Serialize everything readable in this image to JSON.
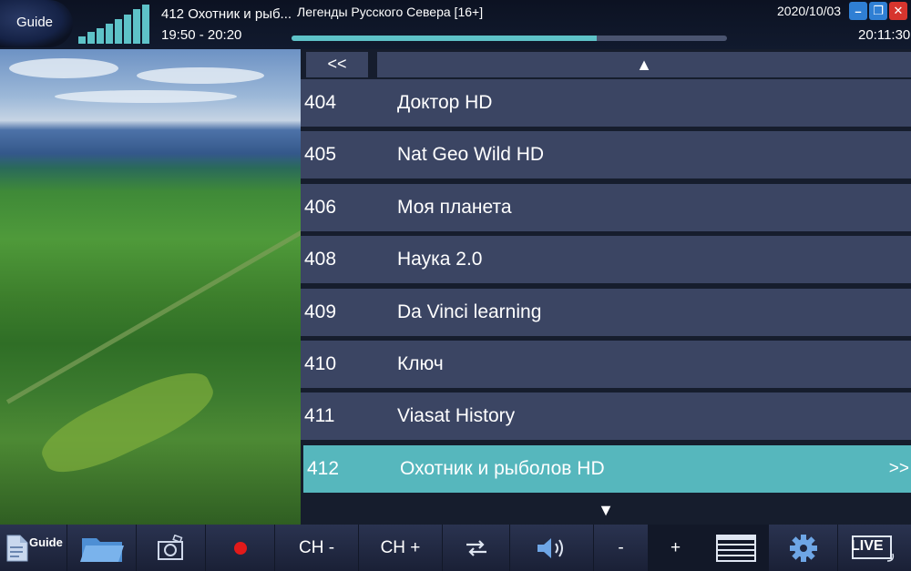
{
  "header": {
    "guide_label": "Guide",
    "signal_levels": [
      0.18,
      0.28,
      0.38,
      0.48,
      0.58,
      0.7,
      0.82,
      0.94
    ],
    "current_channel": "412 Охотник и рыб...",
    "time_range": "19:50 - 20:20",
    "program_name": "Легенды Русского Севера [16+]",
    "progress_percent": 70,
    "date": "2020/10/03",
    "clock": "20:11:30",
    "accent_color": "#5ec2c8"
  },
  "window_buttons": {
    "minimize": "–",
    "restore": "❐",
    "close": "✕"
  },
  "list": {
    "prev_label": "<<",
    "up_glyph": "▲",
    "down_glyph": "▼",
    "more_label": ">>",
    "selected_color": "#56b7bd",
    "channels": [
      {
        "num": "404",
        "name": "Доктор HD"
      },
      {
        "num": "405",
        "name": "Nat Geo Wild HD"
      },
      {
        "num": "406",
        "name": "Моя планета"
      },
      {
        "num": "408",
        "name": "Наука 2.0"
      },
      {
        "num": "409",
        "name": "Da Vinci learning"
      },
      {
        "num": "410",
        "name": "Ключ"
      },
      {
        "num": "411",
        "name": "Viasat History"
      },
      {
        "num": "412",
        "name": "Охотник и рыболов HD"
      }
    ]
  },
  "toolbar": {
    "guide_label": "Guide",
    "ch_minus": "CH -",
    "ch_plus": "CH +",
    "vol_minus": "-",
    "vol_plus": "+",
    "live_label": "LIVE",
    "icons": [
      "guide-doc-icon",
      "folder-icon",
      "camera-icon",
      "record-icon",
      "swap-icon",
      "speaker-icon",
      "list-icon",
      "gear-icon",
      "live-icon"
    ]
  }
}
